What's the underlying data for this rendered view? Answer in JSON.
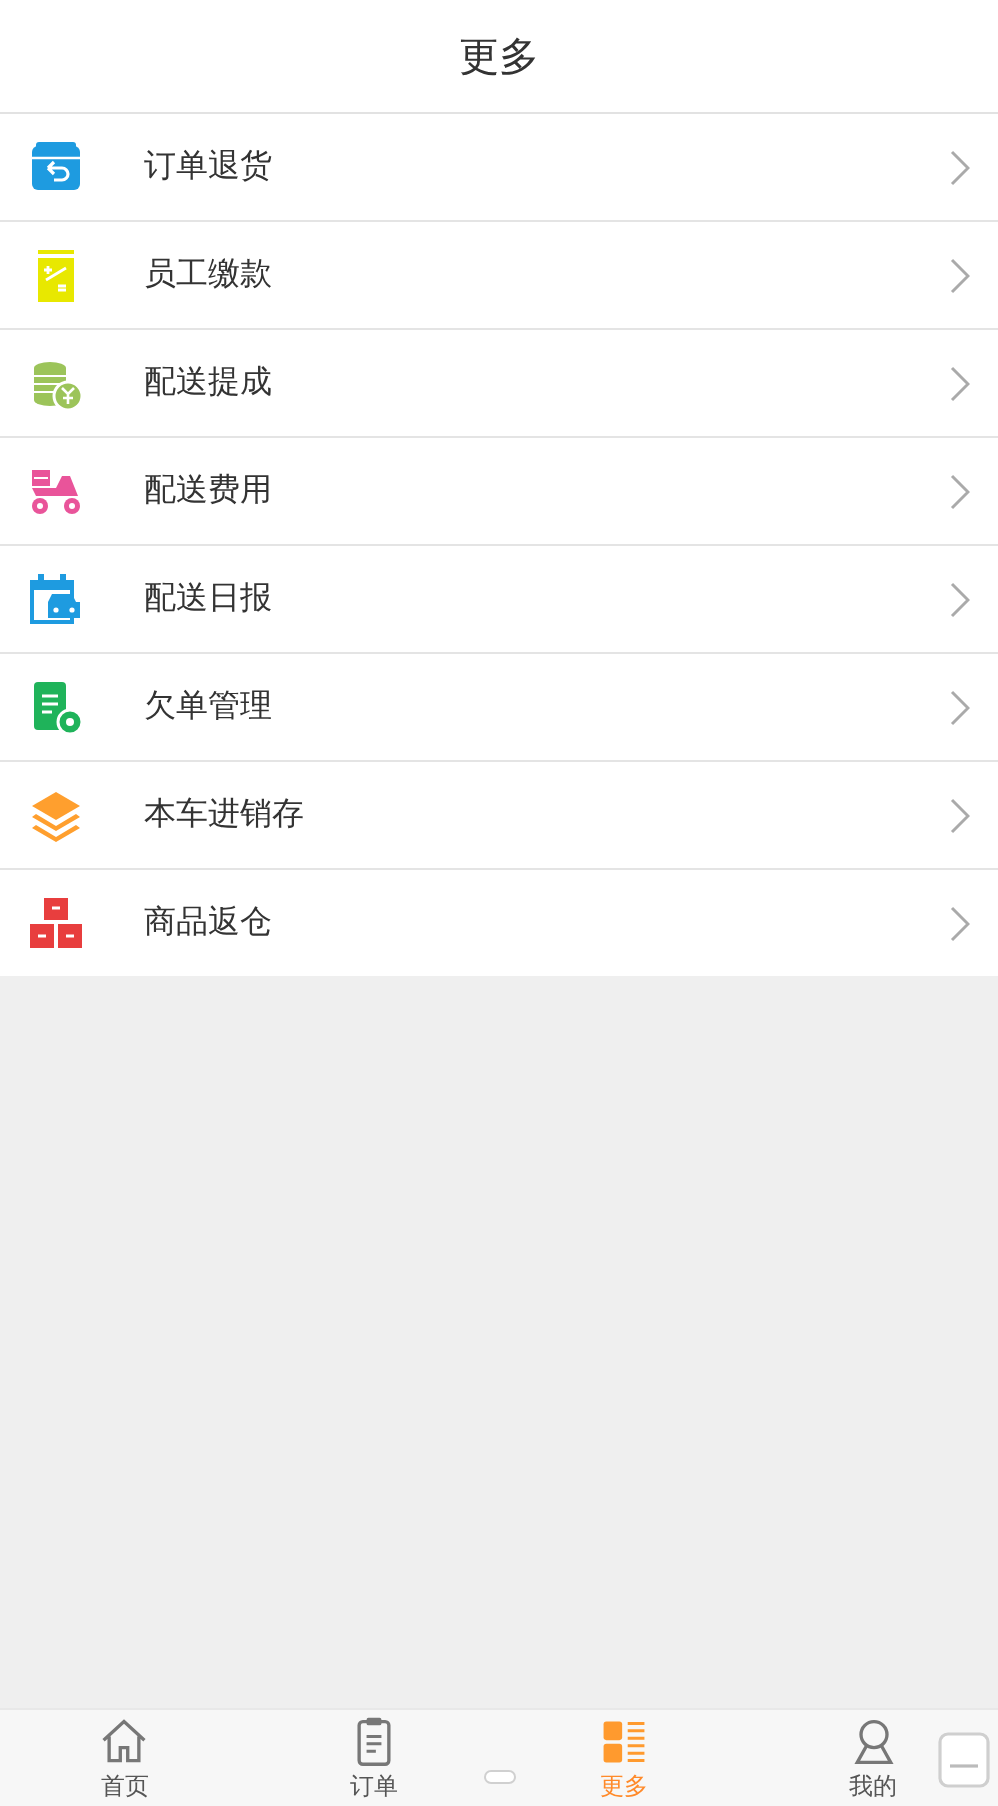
{
  "header": {
    "title": "更多"
  },
  "menu": [
    {
      "kind": "return",
      "label": "订单退货"
    },
    {
      "kind": "payment",
      "label": "员工缴款"
    },
    {
      "kind": "coins",
      "label": "配送提成"
    },
    {
      "kind": "scooter",
      "label": "配送费用"
    },
    {
      "kind": "calendar",
      "label": "配送日报"
    },
    {
      "kind": "debt",
      "label": "欠单管理"
    },
    {
      "kind": "layers",
      "label": "本车进销存"
    },
    {
      "kind": "boxes",
      "label": "商品返仓"
    }
  ],
  "tab_bar": [
    {
      "kind": "home",
      "label": "首页",
      "selected": false
    },
    {
      "kind": "orders",
      "label": "订单",
      "selected": false
    },
    {
      "kind": "more",
      "label": "更多",
      "selected": true
    },
    {
      "kind": "profile",
      "label": "我的",
      "selected": false
    }
  ]
}
